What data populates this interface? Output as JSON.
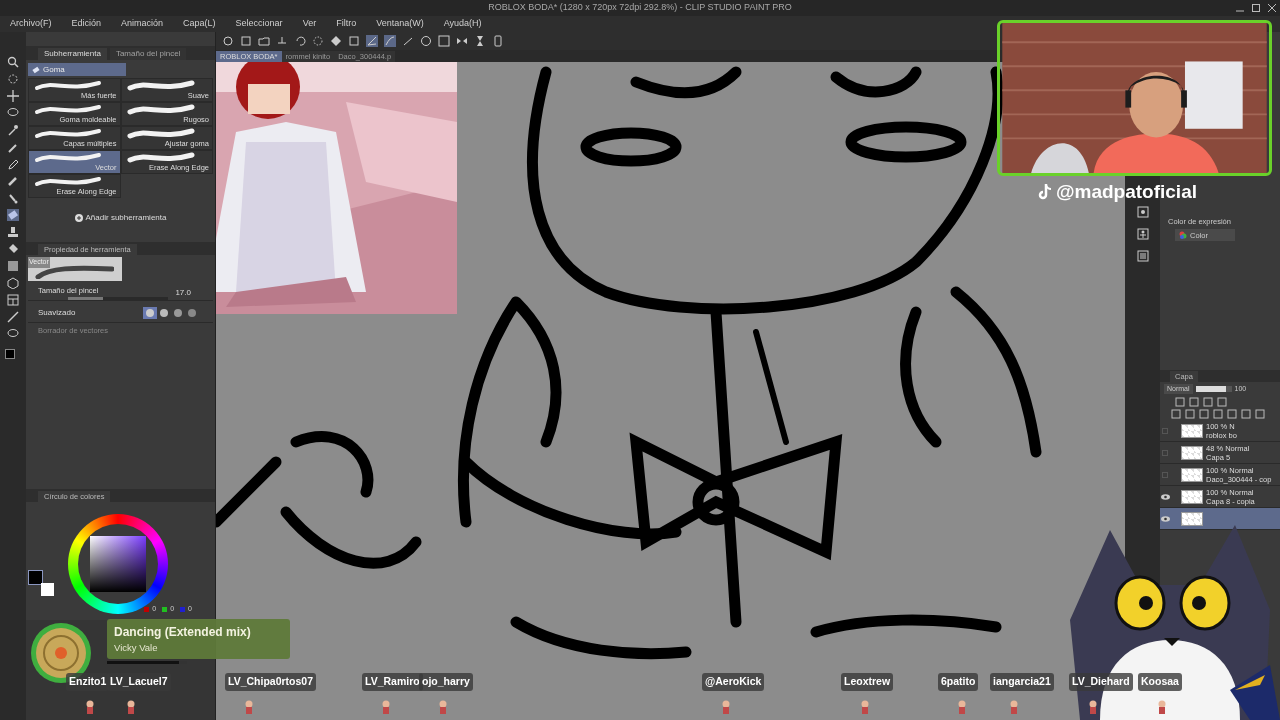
{
  "window": {
    "title": "ROBLOX BODA* (1280 x 720px 72dpi 292.8%)  - CLIP STUDIO PAINT PRO"
  },
  "menu": [
    "Archivo(F)",
    "Edición",
    "Animación",
    "Capa(L)",
    "Seleccionar",
    "Ver",
    "Filtro",
    "Ventana(W)",
    "Ayuda(H)"
  ],
  "canvas_tabs": [
    {
      "label": "ROBLOX BODA*",
      "selected": true
    },
    {
      "label": "rommel kinito",
      "selected": false
    },
    {
      "label": "Daco_300444.p",
      "selected": false
    }
  ],
  "subtool_panel": {
    "tabs": [
      {
        "label": "Subherramienta",
        "selected": true
      },
      {
        "label": "Tamaño del pincel",
        "selected": false
      }
    ],
    "group": "Goma",
    "brushes": [
      {
        "label": "Más fuerte",
        "selected": false
      },
      {
        "label": "Suave",
        "selected": false
      },
      {
        "label": "Goma moldeable",
        "selected": false
      },
      {
        "label": "Rugoso",
        "selected": false
      },
      {
        "label": "Capas múltiples",
        "selected": false
      },
      {
        "label": "Ajustar goma",
        "selected": false
      },
      {
        "label": "Vector",
        "selected": true
      },
      {
        "label": "Erase Along Edge",
        "selected": false
      },
      {
        "label": "Erase Along Edge",
        "selected": false
      }
    ],
    "add_button": "Añadir subherramienta"
  },
  "tool_property": {
    "tab": "Propiedad de herramienta",
    "preview_label": "Vector",
    "brush_size_label": "Tamaño del pincel",
    "brush_size": "17.0",
    "brush_size_slider": {
      "level": 0.35
    },
    "smoothing_label": "Suavizado",
    "vector_eraser_label": "Borrador de vectores"
  },
  "color_wheel": {
    "tab": "Círculo de colores",
    "r": "0",
    "g": "0",
    "b": "0"
  },
  "expression": {
    "label": "Color de expresión",
    "value": "Color"
  },
  "layers": {
    "tab": "Capa",
    "blend": "Normal",
    "opacity": "100",
    "opacity_slider": {
      "level": 0.85
    },
    "items": [
      {
        "line1": "100 % N",
        "line2": "roblox bo",
        "visible": false,
        "selected": false
      },
      {
        "line1": "48 % Normal",
        "line2": "Capa 5",
        "visible": false,
        "selected": false
      },
      {
        "line1": "100 % Normal",
        "line2": "Daco_300444 - cop",
        "visible": false,
        "selected": false
      },
      {
        "line1": "100 % Normal",
        "line2": "Capa 8 - copia",
        "visible": true,
        "selected": false
      },
      {
        "visible": true,
        "selected": true
      }
    ]
  },
  "stream_overlay": {
    "handle": "@madpatoficial",
    "song": {
      "title": "Dancing (Extended mix)",
      "artist": "Vicky Vale",
      "level": 0.9
    },
    "chat_names": [
      "Enzito1",
      "LV_Lacuel7",
      "LV_Chipa0rtos07",
      "LV_Ramiro",
      "ojo_harry",
      "@AeroKick",
      "Leoxtrew",
      "6patito",
      "iangarcia21",
      "LV_Diehard",
      "Koosaa"
    ]
  }
}
